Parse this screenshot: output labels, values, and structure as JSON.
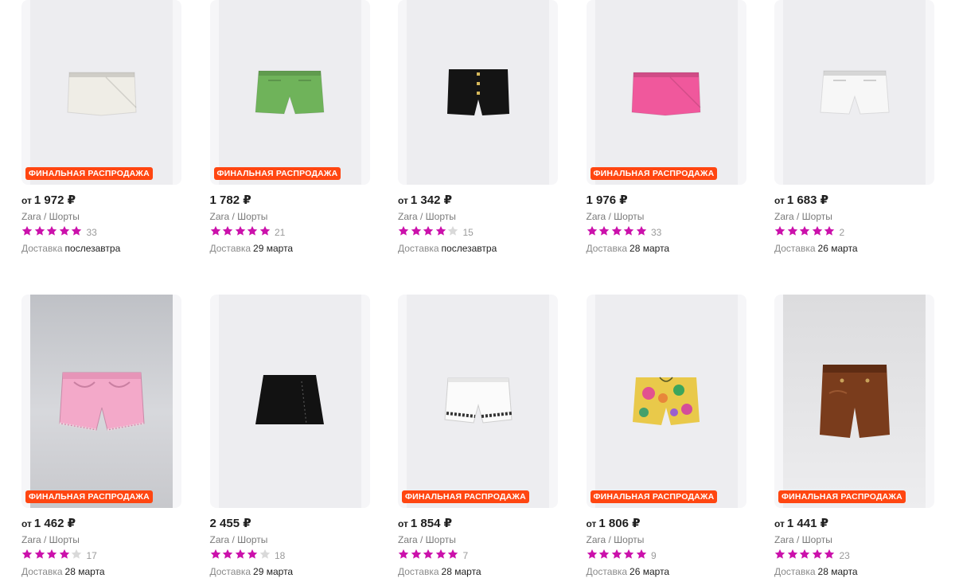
{
  "colors": {
    "accent_star": "#cb11ab",
    "star_empty": "#d9d9d9",
    "badge_bg": "#ff4611",
    "badge_text": "#ffffff"
  },
  "labels": {
    "from": "от",
    "delivery": "Доставка",
    "sale_badge": "ФИНАЛЬНАЯ РАСПРОДАЖА"
  },
  "products": [
    {
      "price": "1 972 ₽",
      "from": true,
      "brand": "Zara",
      "category": "Шорты",
      "rating": 5,
      "reviews": "33",
      "delivery": "послезавтра",
      "badge": true,
      "garment": "skort",
      "color": "#efede6",
      "photo": "plain"
    },
    {
      "price": "1 782 ₽",
      "from": false,
      "brand": "Zara",
      "category": "Шорты",
      "rating": 5,
      "reviews": "21",
      "delivery": "29 марта",
      "badge": true,
      "garment": "shorts",
      "color": "#6fb35a",
      "photo": "plain"
    },
    {
      "price": "1 342 ₽",
      "from": true,
      "brand": "Zara",
      "category": "Шорты",
      "rating": 4,
      "reviews": "15",
      "delivery": "послезавтра",
      "badge": false,
      "garment": "buttons",
      "color": "#141414",
      "photo": "plain"
    },
    {
      "price": "1 976 ₽",
      "from": false,
      "brand": "Zara",
      "category": "Шорты",
      "rating": 5,
      "reviews": "33",
      "delivery": "28 марта",
      "badge": true,
      "garment": "skort",
      "color": "#f0589c",
      "photo": "plain"
    },
    {
      "price": "1 683 ₽",
      "from": true,
      "brand": "Zara",
      "category": "Шорты",
      "rating": 5,
      "reviews": "2",
      "delivery": "26 марта",
      "badge": false,
      "garment": "shorts",
      "color": "#f7f7f7",
      "photo": "plain"
    },
    {
      "price": "1 462 ₽",
      "from": true,
      "brand": "Zara",
      "category": "Шорты",
      "rating": 4,
      "reviews": "17",
      "delivery": "28 марта",
      "badge": true,
      "garment": "denim",
      "color": "#f3a9c9",
      "photo": "studio"
    },
    {
      "price": "2 455 ₽",
      "from": false,
      "brand": "Zara",
      "category": "Шорты",
      "rating": 4,
      "reviews": "18",
      "delivery": "29 марта",
      "badge": false,
      "garment": "skirt",
      "color": "#121212",
      "photo": "plain"
    },
    {
      "price": "1 854 ₽",
      "from": true,
      "brand": "Zara",
      "category": "Шорты",
      "rating": 5,
      "reviews": "7",
      "delivery": "28 марта",
      "badge": true,
      "garment": "embroidered",
      "color": "#fbfbfb",
      "photo": "plain"
    },
    {
      "price": "1 806 ₽",
      "from": true,
      "brand": "Zara",
      "category": "Шорты",
      "rating": 5,
      "reviews": "9",
      "delivery": "26 марта",
      "badge": true,
      "garment": "floral",
      "color": "#e9c94a",
      "photo": "plain"
    },
    {
      "price": "1 441 ₽",
      "from": true,
      "brand": "Zara",
      "category": "Шорты",
      "rating": 5,
      "reviews": "23",
      "delivery": "28 марта",
      "badge": true,
      "garment": "leather",
      "color": "#7a3c1c",
      "photo": "studio-grey"
    }
  ]
}
